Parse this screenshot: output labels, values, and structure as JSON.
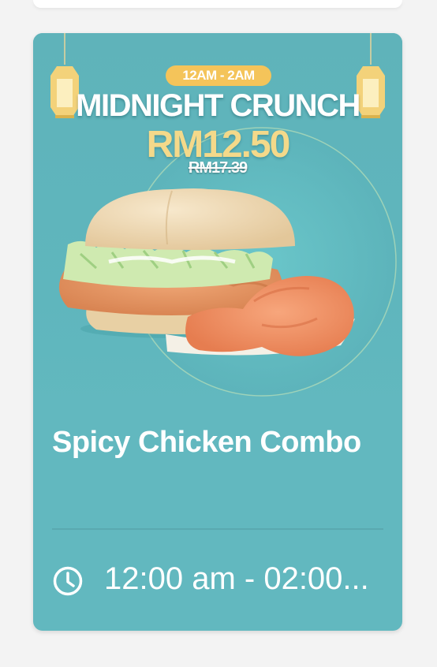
{
  "promo": {
    "time_pill": "12AM - 2AM",
    "title": "MIDNIGHT CRUNCH",
    "price": "RM12.50",
    "old_price": "RM17.39"
  },
  "product": {
    "name": "Spicy Chicken Combo",
    "hours": "12:00 am - 02:00..."
  },
  "colors": {
    "card_bg": "#62b8bf",
    "pill": "#f4c45a",
    "price": "#f4d98a"
  },
  "icons": {
    "lantern": "lantern-icon",
    "clock": "clock-icon"
  }
}
